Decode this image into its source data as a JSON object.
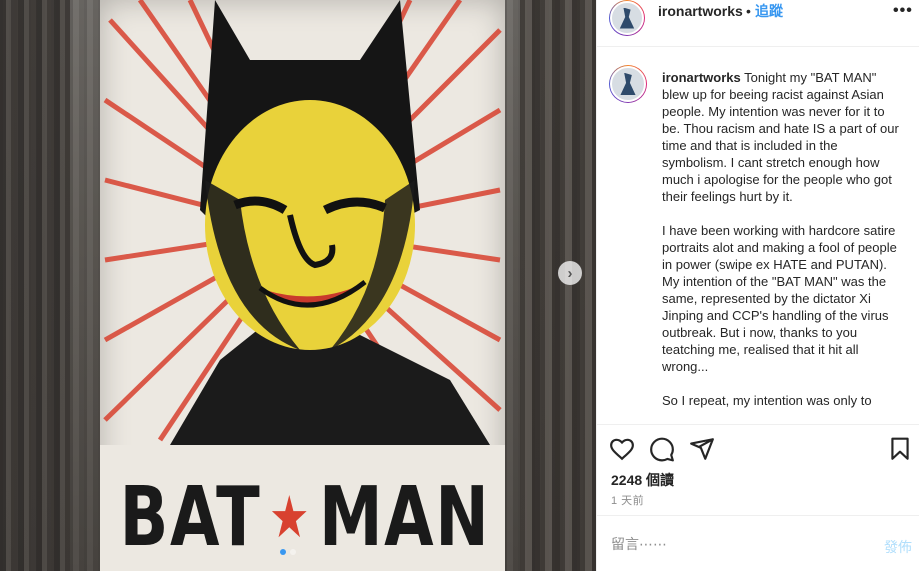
{
  "post": {
    "username": "ironartworks",
    "separator": "•",
    "follow_label": "追蹤",
    "more_label": "•••"
  },
  "image": {
    "poster_text_left": "BAT",
    "poster_text_right": "MAN",
    "star_glyph": "★",
    "carousel_next_glyph": "›",
    "accent_red": "#d8412f",
    "accent_yellow": "#e9d23a",
    "carousel_page": 1,
    "carousel_count": 2
  },
  "caption": {
    "username": "ironartworks",
    "text": " Tonight my \"BAT MAN\" blew up for beeing racist against Asian people. My intention was never for it to be. Thou racism and hate IS a part of our time and that is included in the symbolism. I cant stretch enough how much i apologise for the people who got their feelings hurt by it.\n\nI have been working with hardcore satire portraits alot and making a fool of people in power (swipe ex HATE and PUTAN). My intention of the \"BAT MAN\" was the same, represented by the dictator Xi Jinping and CCP's handling of the virus outbreak. But i now, thanks to you teatching me, realised that it hit all wrong...\n\nSo I repeat, my intention was only to"
  },
  "actions": {
    "like_icon": "heart-icon",
    "comment_icon": "comment-icon",
    "share_icon": "share-icon",
    "save_icon": "bookmark-icon"
  },
  "stats": {
    "views": "2248 個讀",
    "time_ago": "1 天前"
  },
  "comment": {
    "placeholder": "留言⋯⋯",
    "post_label": "發佈"
  },
  "colors": {
    "link_blue": "#3897f0",
    "post_disabled": "#b2dffc",
    "muted_text": "#8e8e8e"
  }
}
